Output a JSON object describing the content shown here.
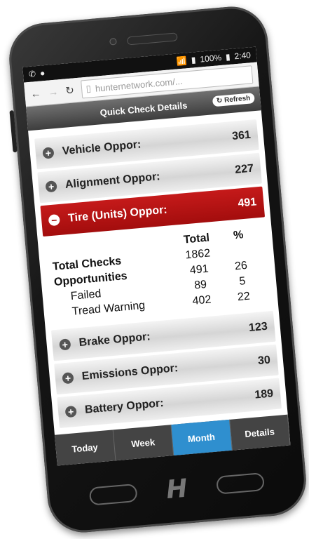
{
  "status": {
    "battery": "100%",
    "time": "2:40"
  },
  "browser": {
    "url": "hunternetwork.com/..."
  },
  "header": {
    "title": "Quick Check Details",
    "refresh_label": "Refresh"
  },
  "rows": [
    {
      "label": "Vehicle Oppor:",
      "value": "361"
    },
    {
      "label": "Alignment Oppor:",
      "value": "227"
    },
    {
      "label": "Tire (Units) Oppor:",
      "value": "491"
    },
    {
      "label": "Brake Oppor:",
      "value": "123"
    },
    {
      "label": "Emissions Oppor:",
      "value": "30"
    },
    {
      "label": "Battery Oppor:",
      "value": "189"
    }
  ],
  "detail": {
    "col_total": "Total",
    "col_pct": "%",
    "lines": [
      {
        "label": "Total Checks",
        "total": "1862",
        "pct": ""
      },
      {
        "label": "Opportunities",
        "total": "491",
        "pct": "26"
      },
      {
        "label": "Failed",
        "total": "89",
        "pct": "5"
      },
      {
        "label": "Tread Warning",
        "total": "402",
        "pct": "22"
      }
    ]
  },
  "tabs": [
    "Today",
    "Week",
    "Month",
    "Details"
  ],
  "colors": {
    "accent_red": "#a30d0d",
    "tab_active": "#2f8fcf"
  }
}
